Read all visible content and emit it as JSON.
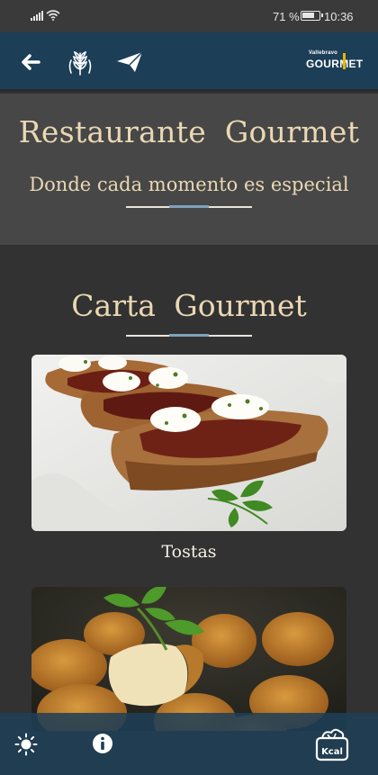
{
  "status_bar": {
    "battery_percent": "71 %",
    "time": "10:36"
  },
  "app_bar": {
    "icons": [
      "back-arrow-icon",
      "wheat-icon",
      "paper-plane-icon"
    ],
    "brand_small": "Vallebravo",
    "brand_big": "GOURMET"
  },
  "hero": {
    "title": "Restaurante Gourmet",
    "tagline": "Donde cada momento es especial"
  },
  "menu": {
    "title": "Carta Gourmet",
    "items": [
      {
        "label": "Tostas",
        "image": "tostas-photo"
      },
      {
        "label": "",
        "image": "croquetas-photo"
      }
    ]
  },
  "bottom_bar": {
    "icons": [
      "sun-icon",
      "info-icon",
      "kcal-icon"
    ],
    "kcal_label": "Kcal"
  },
  "colors": {
    "app_bar": "#1c3e57",
    "hero_bg": "#474747",
    "page_bg": "#323232",
    "title_text": "#ead8b4",
    "divider_accent": "#7fa2bb"
  }
}
